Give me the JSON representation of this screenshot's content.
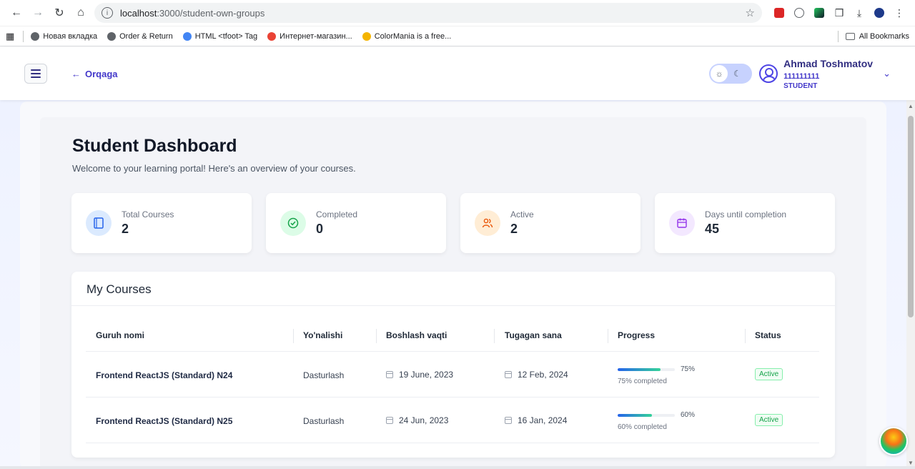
{
  "browser": {
    "url_host": "localhost",
    "url_path": ":3000/student-own-groups",
    "bookmarks": [
      {
        "label": "Новая вкладка",
        "color": "#5f6368"
      },
      {
        "label": "Order & Return",
        "color": "#5f6368"
      },
      {
        "label": "HTML <tfoot> Tag",
        "color": "#4285f4"
      },
      {
        "label": "Интернет-магазин...",
        "color": "#ea4335"
      },
      {
        "label": "ColorMania is a free...",
        "color": "#f4b400"
      }
    ],
    "all_bookmarks": "All Bookmarks"
  },
  "header": {
    "back_label": "Orqaga",
    "user": {
      "name": "Ahmad Toshmatov",
      "phone": "111111111",
      "role": "STUDENT"
    }
  },
  "dashboard": {
    "title": "Student Dashboard",
    "subtitle": "Welcome to your learning portal! Here's an overview of your courses.",
    "stats": [
      {
        "label": "Total Courses",
        "value": "2",
        "icon": "book-icon",
        "bg": "#dbeafe",
        "fg": "#2563eb"
      },
      {
        "label": "Completed",
        "value": "0",
        "icon": "check-circle-icon",
        "bg": "#dcfce7",
        "fg": "#16a34a"
      },
      {
        "label": "Active",
        "value": "2",
        "icon": "users-icon",
        "bg": "#ffedd5",
        "fg": "#ea580c"
      },
      {
        "label": "Days until completion",
        "value": "45",
        "icon": "calendar-icon",
        "bg": "#f3e8ff",
        "fg": "#9333ea"
      }
    ]
  },
  "courses": {
    "title": "My Courses",
    "columns": [
      "Guruh nomi",
      "Yo'nalishi",
      "Boshlash vaqti",
      "Tugagan sana",
      "Progress",
      "Status"
    ],
    "rows": [
      {
        "name": "Frontend ReactJS (Standard) N24",
        "direction": "Dasturlash",
        "start": "19 June, 2023",
        "end": "12 Feb, 2024",
        "progress": 75,
        "progress_pct": "75%",
        "progress_caption": "75% completed",
        "status": "Active"
      },
      {
        "name": "Frontend ReactJS (Standard) N25",
        "direction": "Dasturlash",
        "start": "24 Jun, 2023",
        "end": "16 Jan, 2024",
        "progress": 60,
        "progress_pct": "60%",
        "progress_caption": "60% completed",
        "status": "Active"
      }
    ]
  }
}
